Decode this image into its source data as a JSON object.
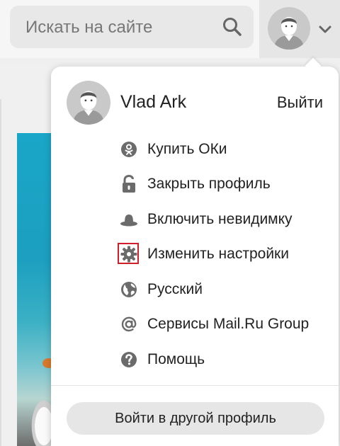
{
  "search": {
    "placeholder": "Искать на сайте"
  },
  "user_menu": {
    "name": "Vlad Ark",
    "logout_label": "Выйти",
    "items": [
      {
        "label": "Купить ОКи",
        "icon": "ok-coin-icon"
      },
      {
        "label": "Закрыть профиль",
        "icon": "lock-icon"
      },
      {
        "label": "Включить невидимку",
        "icon": "hat-icon"
      },
      {
        "label": "Изменить настройки",
        "icon": "gear-icon",
        "highlighted": true
      },
      {
        "label": "Русский",
        "icon": "globe-icon"
      },
      {
        "label": "Сервисы Mail.Ru Group",
        "icon": "at-icon"
      },
      {
        "label": "Помощь",
        "icon": "help-icon"
      }
    ],
    "switch_profile_label": "Войти в другой профиль"
  },
  "colors": {
    "highlight": "#d01f2a",
    "icon": "#6b6b6b",
    "button_bg": "#e6e6e6"
  }
}
